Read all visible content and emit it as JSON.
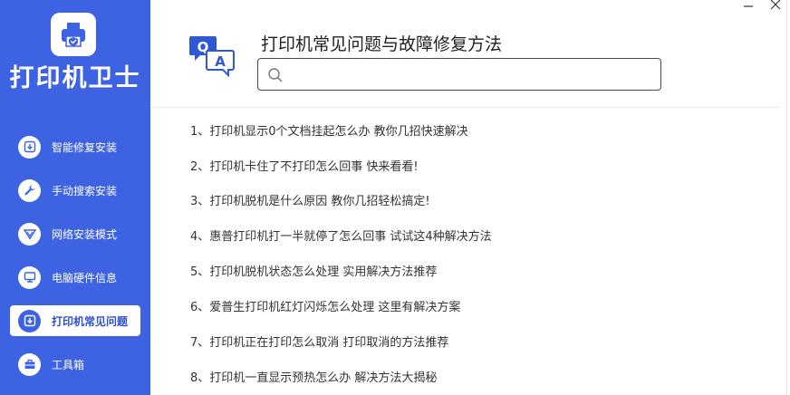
{
  "app": {
    "name": "打印机卫士",
    "logo_icon": "printer-shield-icon",
    "brand_color": "#3d63e3"
  },
  "window": {
    "minimize_icon": "minimize-icon",
    "close_icon": "close-icon"
  },
  "sidebar": {
    "items": [
      {
        "label": "智能修复安装",
        "icon": "download-icon",
        "active": false
      },
      {
        "label": "手动搜索安装",
        "icon": "wrench-icon",
        "active": false
      },
      {
        "label": "网络安装模式",
        "icon": "network-icon",
        "active": false
      },
      {
        "label": "电脑硬件信息",
        "icon": "computer-icon",
        "active": false
      },
      {
        "label": "打印机常见问题",
        "icon": "download-icon",
        "active": true
      },
      {
        "label": "工具箱",
        "icon": "toolbox-icon",
        "active": false
      }
    ]
  },
  "header": {
    "icon": "qa-icon",
    "title": "打印机常见问题与故障修复方法",
    "search_value": "",
    "search_icon": "search-icon"
  },
  "faq": {
    "items": [
      "1、打印机显示0个文档挂起怎么办 教你几招快速解决",
      "2、打印机卡住了不打印怎么回事 快来看看!",
      "3、打印机脱机是什么原因 教你几招轻松搞定!",
      "4、惠普打印机打一半就停了怎么回事 试试这4种解决方法",
      "5、打印机脱机状态怎么处理 实用解决方法推荐",
      "6、爱普生打印机红灯闪烁怎么处理 这里有解决方案",
      "7、打印机正在打印怎么取消 打印取消的方法推荐",
      "8、打印机一直显示预热怎么办 解决方法大揭秘"
    ]
  }
}
